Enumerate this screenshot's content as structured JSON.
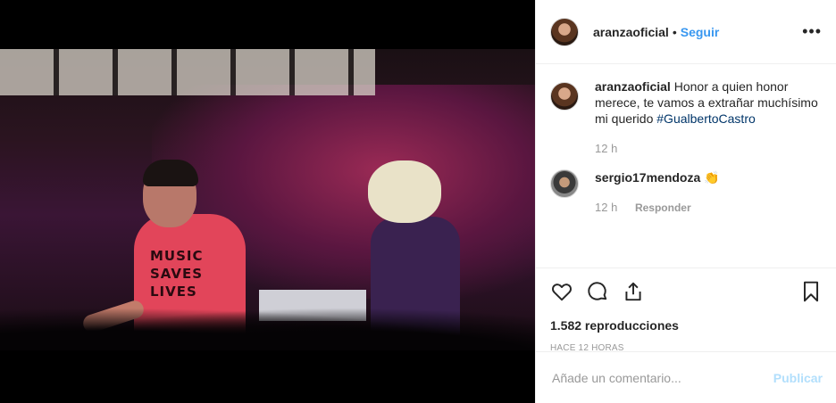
{
  "post": {
    "username": "aranzaoficial",
    "follow_label": "Seguir",
    "separator": "•",
    "more_icon": "more-horizontal-icon"
  },
  "video": {
    "shirt_text": "MUSIC SAVES LIVES"
  },
  "caption": {
    "username": "aranzaoficial",
    "text": "Honor a quien honor merece, te vamos a extrañar muchísimo mi querido",
    "hashtag": "#GualbertoCastro",
    "time": "12 h"
  },
  "comments": [
    {
      "username": "sergio17mendoza",
      "text": "👏",
      "time": "12 h",
      "reply_label": "Responder"
    }
  ],
  "actions": {
    "like_icon": "heart-icon",
    "comment_icon": "comment-bubble-icon",
    "share_icon": "share-icon",
    "save_icon": "bookmark-icon"
  },
  "stats": {
    "views": "1.582 reproducciones",
    "ago": "HACE 12 HORAS"
  },
  "add_comment": {
    "placeholder": "Añade un comentario...",
    "publish_label": "Publicar"
  },
  "colors": {
    "accent": "#3897f0",
    "publish_disabled": "#b2dffc",
    "hashtag": "#003569"
  }
}
